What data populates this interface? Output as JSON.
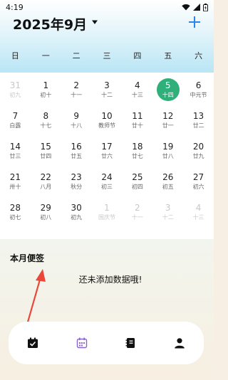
{
  "status_bar": {
    "time": "4:19"
  },
  "header": {
    "title": "2025年9月",
    "caret_icon": "caret-down-icon",
    "add_icon": "plus-icon"
  },
  "weekdays": [
    "日",
    "一",
    "二",
    "三",
    "四",
    "五",
    "六"
  ],
  "colors": {
    "accent": "#2a86e8",
    "today": "#2fb07b",
    "nav_active": "#8a63d2"
  },
  "weeks": [
    [
      {
        "num": "31",
        "lunar": "初九",
        "other": true
      },
      {
        "num": "1",
        "lunar": "初十"
      },
      {
        "num": "2",
        "lunar": "十一"
      },
      {
        "num": "3",
        "lunar": "十二"
      },
      {
        "num": "4",
        "lunar": "十三"
      },
      {
        "num": "5",
        "lunar": "十四",
        "today": true
      },
      {
        "num": "6",
        "lunar": "中元节"
      }
    ],
    [
      {
        "num": "7",
        "lunar": "白露"
      },
      {
        "num": "8",
        "lunar": "十七"
      },
      {
        "num": "9",
        "lunar": "十八"
      },
      {
        "num": "10",
        "lunar": "教师节"
      },
      {
        "num": "11",
        "lunar": "廿十"
      },
      {
        "num": "12",
        "lunar": "廿一"
      },
      {
        "num": "13",
        "lunar": "廿二"
      }
    ],
    [
      {
        "num": "14",
        "lunar": "廿三"
      },
      {
        "num": "15",
        "lunar": "廿四"
      },
      {
        "num": "16",
        "lunar": "廿五"
      },
      {
        "num": "17",
        "lunar": "廿六"
      },
      {
        "num": "18",
        "lunar": "廿七"
      },
      {
        "num": "19",
        "lunar": "廿八"
      },
      {
        "num": "20",
        "lunar": "廿九"
      }
    ],
    [
      {
        "num": "21",
        "lunar": "卅十"
      },
      {
        "num": "22",
        "lunar": "八月"
      },
      {
        "num": "23",
        "lunar": "秋分"
      },
      {
        "num": "24",
        "lunar": "初三"
      },
      {
        "num": "25",
        "lunar": "初四"
      },
      {
        "num": "26",
        "lunar": "初五"
      },
      {
        "num": "27",
        "lunar": "初六"
      }
    ],
    [
      {
        "num": "28",
        "lunar": "初七"
      },
      {
        "num": "29",
        "lunar": "初八"
      },
      {
        "num": "30",
        "lunar": "初九"
      },
      {
        "num": "1",
        "lunar": "国庆节",
        "other": true
      },
      {
        "num": "2",
        "lunar": "十一",
        "other": true
      },
      {
        "num": "3",
        "lunar": "十二",
        "other": true
      },
      {
        "num": "4",
        "lunar": "十三",
        "other": true
      }
    ]
  ],
  "notes": {
    "title": "本月便签",
    "empty_text": "还未添加数据哦!"
  },
  "nav": [
    {
      "name": "nav-checklist",
      "icon": "calendar-check-icon"
    },
    {
      "name": "nav-calendar",
      "icon": "calendar-grid-icon",
      "active": true
    },
    {
      "name": "nav-notebook",
      "icon": "notebook-icon"
    },
    {
      "name": "nav-profile",
      "icon": "person-icon"
    }
  ]
}
